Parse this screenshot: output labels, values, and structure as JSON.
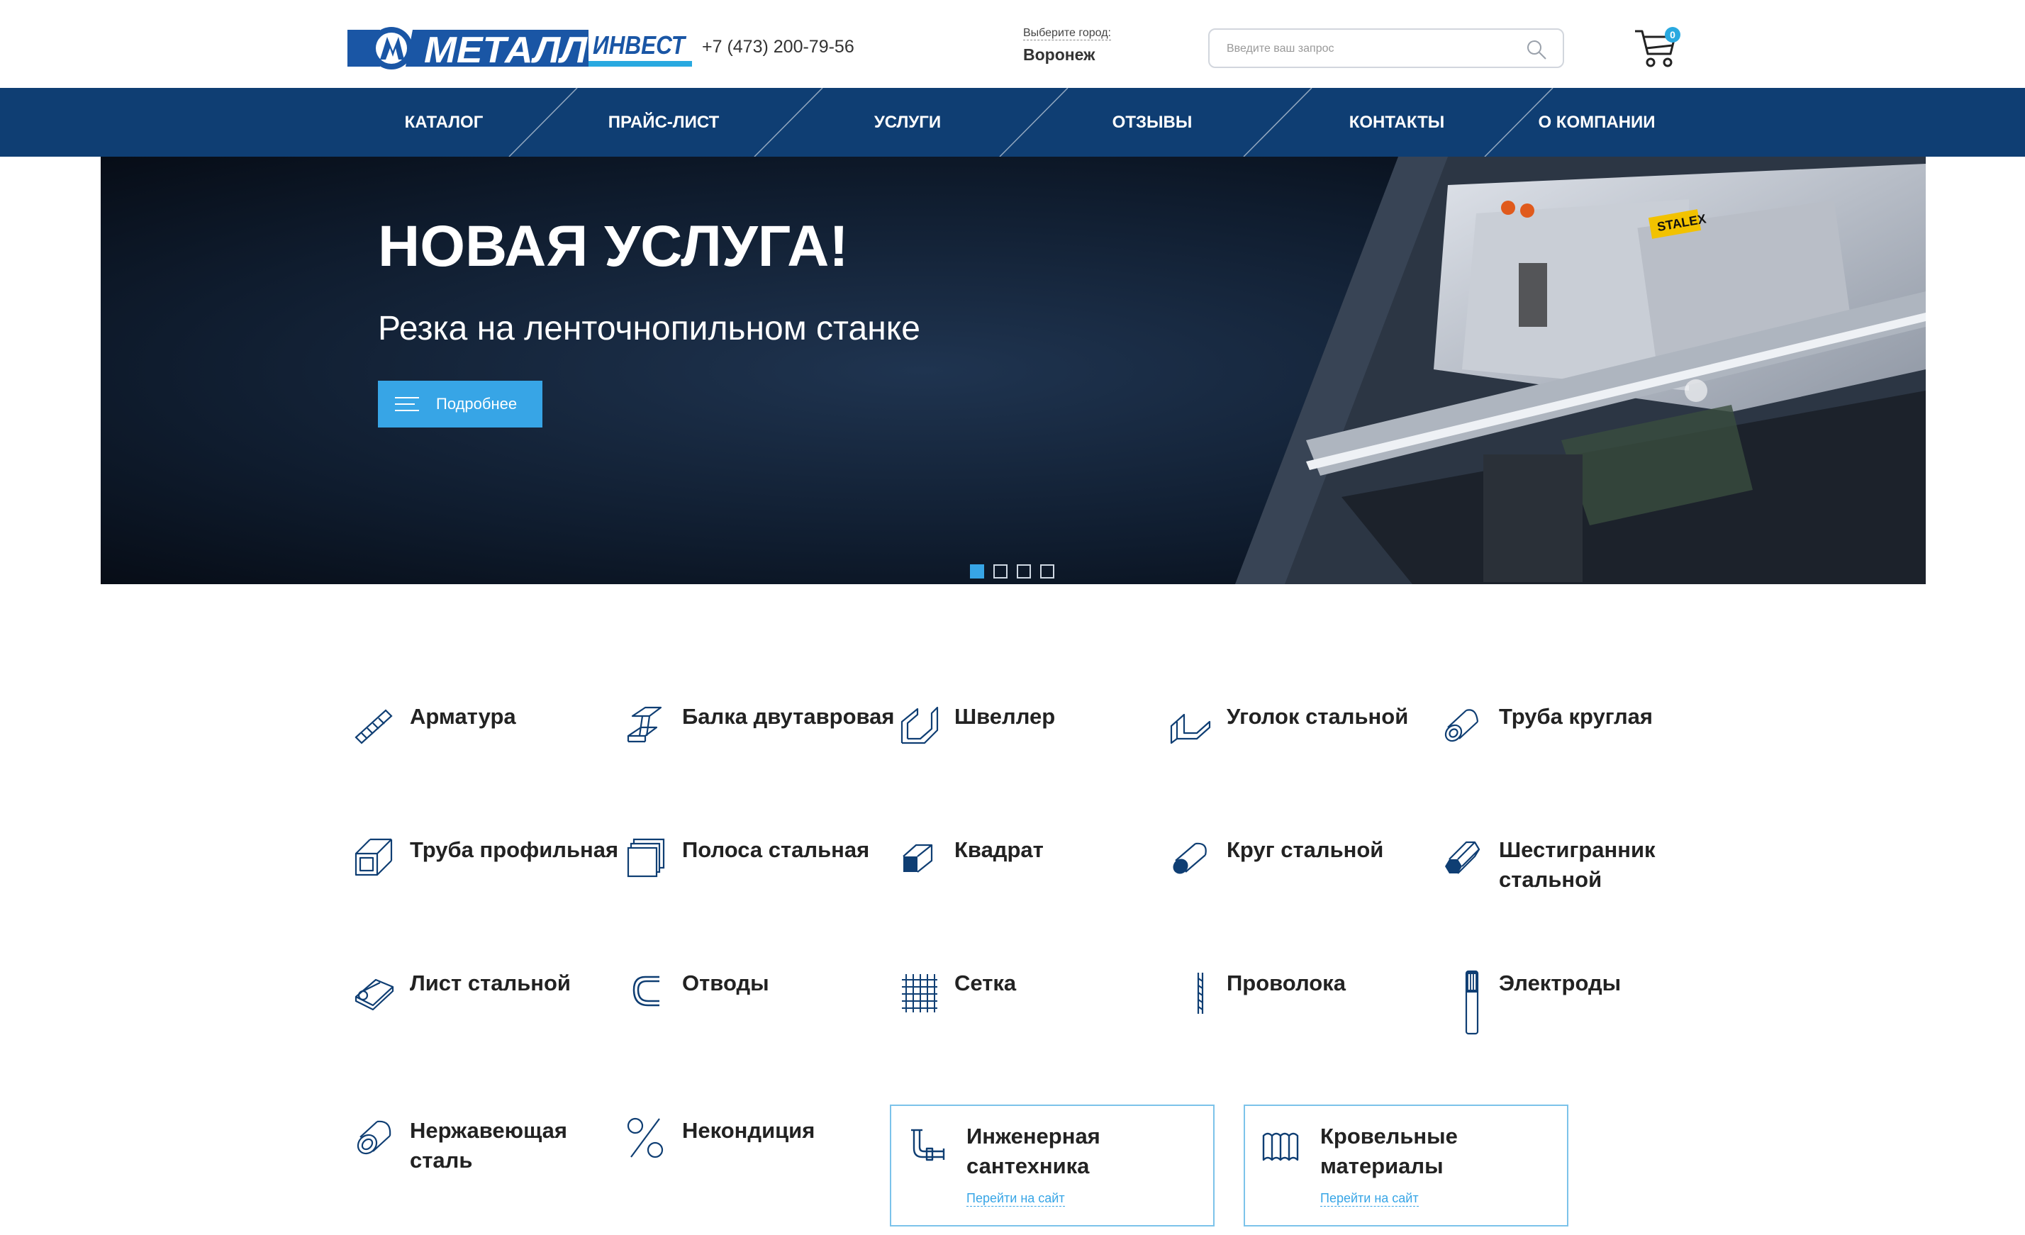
{
  "header": {
    "logo_text": "МЕТАЛЛИНВЕСТ",
    "phone": "+7 (473) 200-79-56",
    "city_label": "Выберите город:",
    "city": "Воронеж",
    "search_placeholder": "Введите ваш запрос",
    "cart_count": "0"
  },
  "nav": {
    "items": [
      {
        "label": "КАТАЛОГ"
      },
      {
        "label": "ПРАЙС-ЛИСТ"
      },
      {
        "label": "УСЛУГИ"
      },
      {
        "label": "ОТЗЫВЫ"
      },
      {
        "label": "КОНТАКТЫ"
      },
      {
        "label": "О КОМПАНИИ"
      }
    ]
  },
  "hero": {
    "title": "НОВАЯ УСЛУГА!",
    "subtitle": "Резка на ленточнопильном станке",
    "button_label": "Подробнее",
    "machine_brand": "STALEX",
    "slide_count": 4,
    "active_slide": 1
  },
  "categories": [
    {
      "name": "Арматура",
      "icon": "rebar-icon"
    },
    {
      "name": "Балка двутавровая",
      "icon": "i-beam-icon"
    },
    {
      "name": "Швеллер",
      "icon": "channel-icon"
    },
    {
      "name": "Уголок стальной",
      "icon": "angle-icon"
    },
    {
      "name": "Труба круглая",
      "icon": "round-pipe-icon"
    },
    {
      "name": "Труба профильная",
      "icon": "profile-pipe-icon"
    },
    {
      "name": "Полоса стальная",
      "icon": "strip-icon"
    },
    {
      "name": "Квадрат",
      "icon": "square-bar-icon"
    },
    {
      "name": "Круг стальной",
      "icon": "round-bar-icon"
    },
    {
      "name": "Шестигранник стальной",
      "icon": "hexagon-bar-icon"
    },
    {
      "name": "Лист стальной",
      "icon": "sheet-icon"
    },
    {
      "name": "Отводы",
      "icon": "elbow-icon"
    },
    {
      "name": "Сетка",
      "icon": "mesh-icon"
    },
    {
      "name": "Проволока",
      "icon": "wire-icon"
    },
    {
      "name": "Электроды",
      "icon": "electrodes-icon"
    },
    {
      "name": "Нержавеющая сталь",
      "icon": "stainless-icon"
    },
    {
      "name": "Некондиция",
      "icon": "percent-icon"
    }
  ],
  "external": [
    {
      "name": "Инженерная сантехника",
      "link": "Перейти на сайт",
      "icon": "plumbing-icon"
    },
    {
      "name": "Кровельные материалы",
      "link": "Перейти на сайт",
      "icon": "roofing-icon"
    }
  ],
  "colors": {
    "nav_bg": "#0f3e73",
    "accent": "#37a5e6",
    "icon_blue": "#0f3e73"
  }
}
